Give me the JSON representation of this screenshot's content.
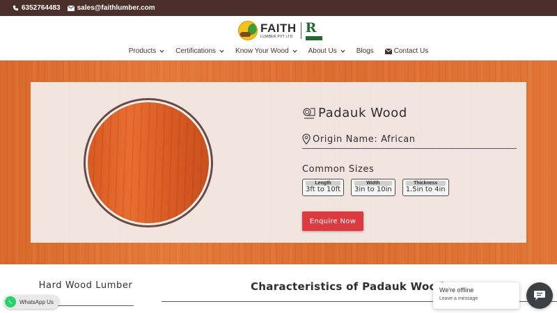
{
  "topbar": {
    "phone": "6352764483",
    "email": "sales@faithlumber.com"
  },
  "logo": {
    "name": "FAITH",
    "subtitle": "LUMBER PVT LTD"
  },
  "nav": [
    {
      "label": "Products",
      "has_dropdown": true
    },
    {
      "label": "Certifications",
      "has_dropdown": true
    },
    {
      "label": "Know Your Wood",
      "has_dropdown": true
    },
    {
      "label": "About Us",
      "has_dropdown": true
    },
    {
      "label": "Blogs",
      "has_dropdown": false
    },
    {
      "label": "Contact Us",
      "has_dropdown": false,
      "icon": "envelope-icon"
    }
  ],
  "product": {
    "title": "Padauk Wood",
    "origin": "Origin Name: African",
    "sizes_heading": "Common Sizes",
    "sizes": [
      {
        "label": "Length",
        "value": "3ft to 10ft"
      },
      {
        "label": "Width",
        "value": "3in to 10in"
      },
      {
        "label": "Thickness",
        "value": "1.5in to 4in"
      }
    ],
    "cta": "Enquire Now"
  },
  "sections": {
    "sidebar_title": "Hard Wood Lumber",
    "main_title": "Characteristics of Padauk Wood"
  },
  "whatsapp": {
    "label": "WhatsApp Us"
  },
  "chat": {
    "status": "We're offline",
    "action": "Leave a message"
  },
  "colors": {
    "topbar": "#4b2f2a",
    "accent_red": "#db3a3f",
    "wood_orange": "#e07636",
    "whatsapp_green": "#25d366"
  }
}
